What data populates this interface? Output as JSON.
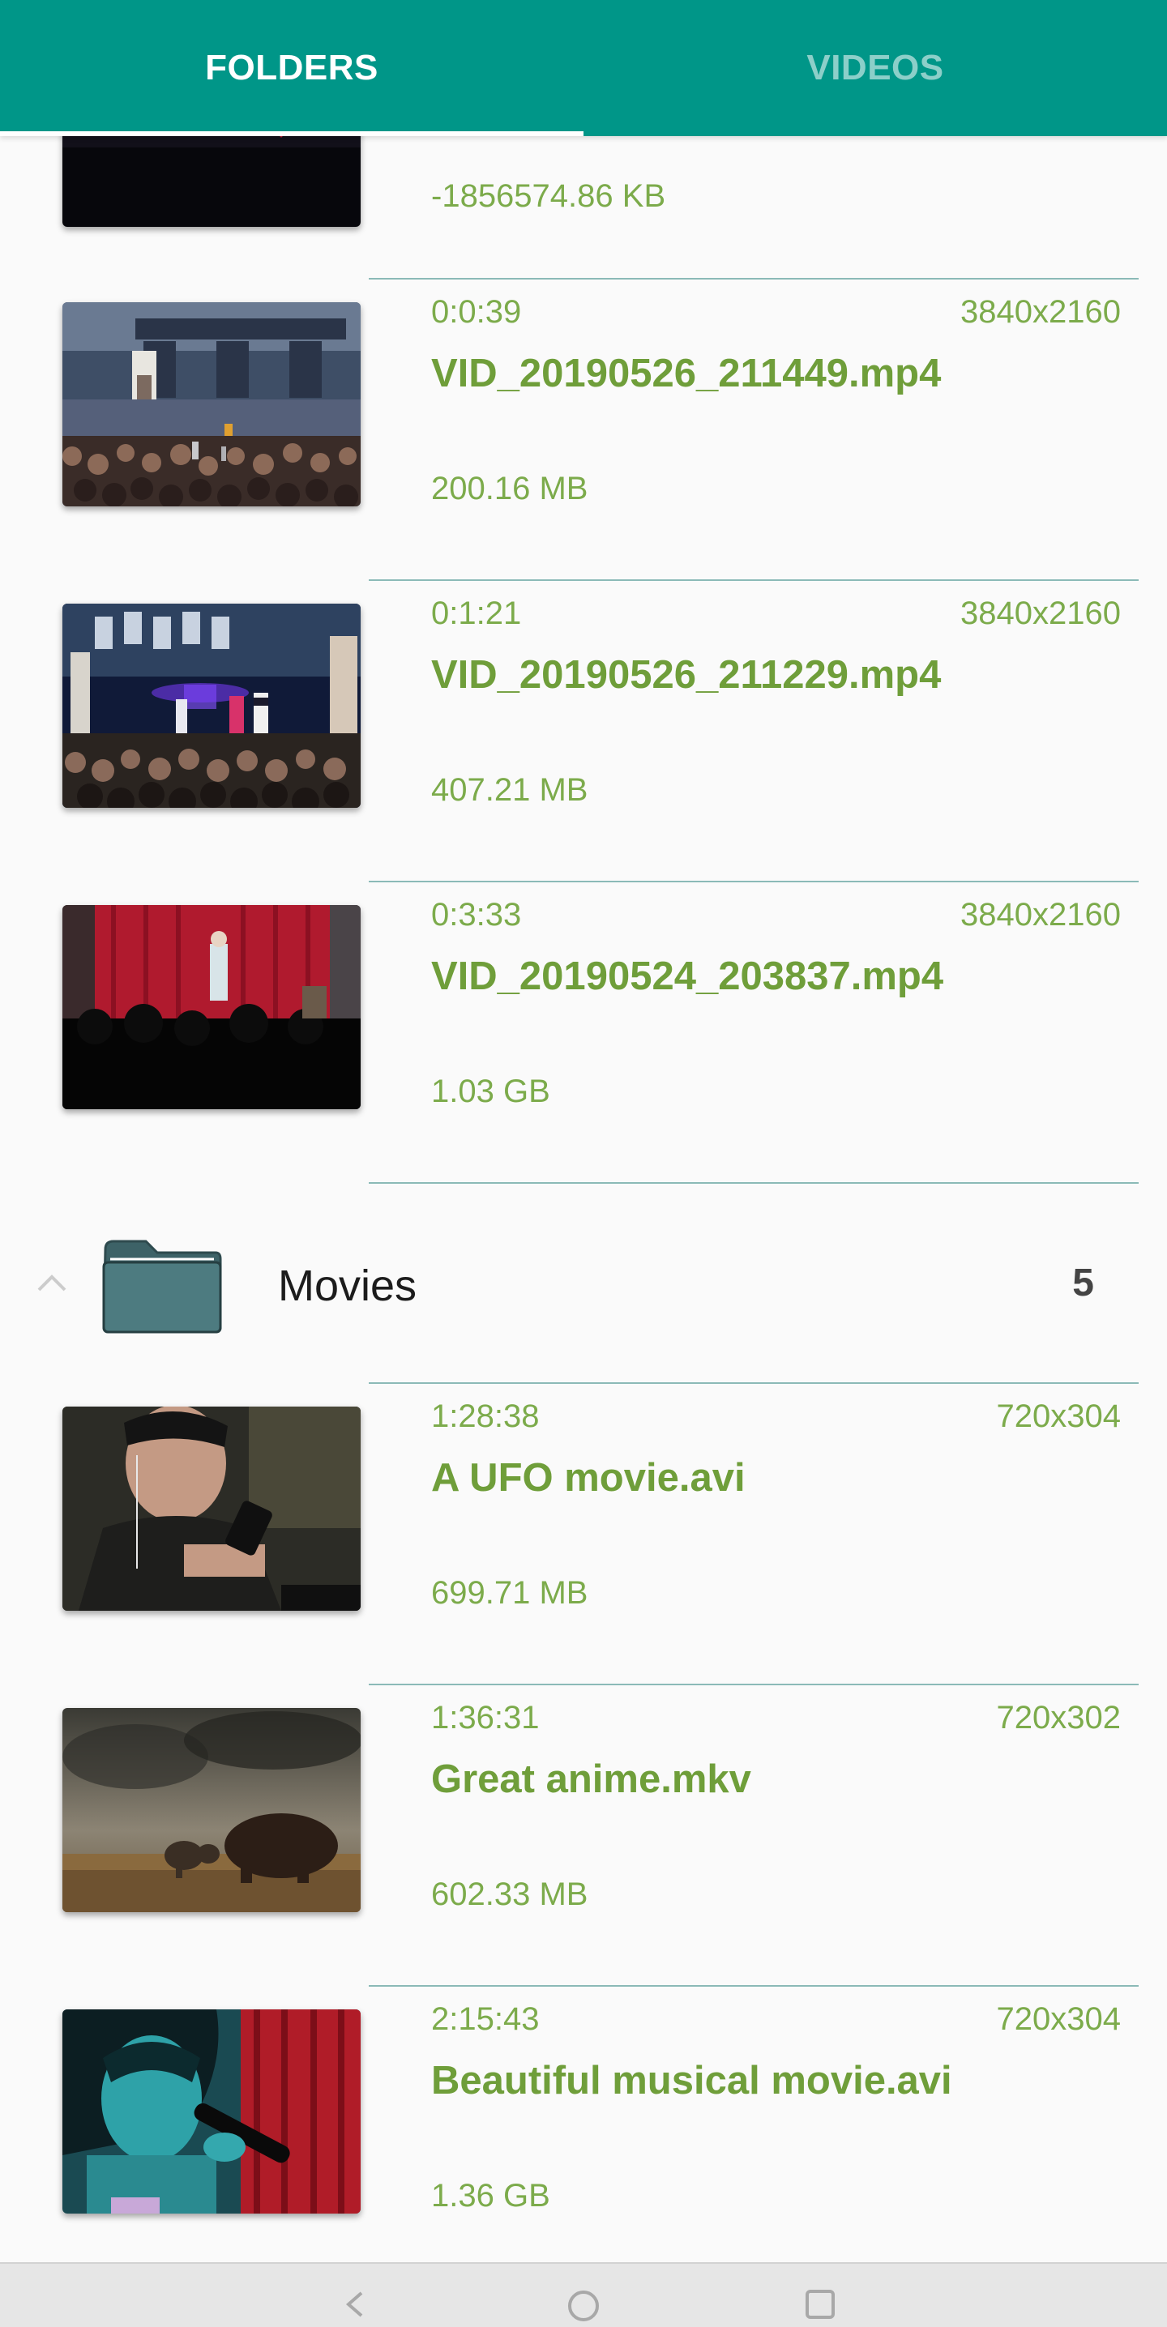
{
  "tabs": [
    {
      "label": "FOLDERS",
      "active": true
    },
    {
      "label": "VIDEOS",
      "active": false
    }
  ],
  "colors": {
    "accent": "#009688",
    "title_green": "#6f9e3a",
    "meta_green": "#7cab4b",
    "divider": "#8bbab7",
    "folder_icon": "#4a7479"
  },
  "partial_item": {
    "size": "-1856574.86 KB"
  },
  "videos": [
    {
      "duration": "0:0:39",
      "resolution": "3840x2160",
      "title": "VID_20190526_211449.mp4",
      "size": "200.16 MB"
    },
    {
      "duration": "0:1:21",
      "resolution": "3840x2160",
      "title": "VID_20190526_211229.mp4",
      "size": "407.21 MB"
    },
    {
      "duration": "0:3:33",
      "resolution": "3840x2160",
      "title": "VID_20190524_203837.mp4",
      "size": "1.03 GB"
    }
  ],
  "folder": {
    "name": "Movies",
    "count": "5",
    "icon": "folder-icon",
    "expand_icon": "chevron-up-icon"
  },
  "movies": [
    {
      "duration": "1:28:38",
      "resolution": "720x304",
      "title": "A UFO movie.avi",
      "size": "699.71 MB"
    },
    {
      "duration": "1:36:31",
      "resolution": "720x302",
      "title": "Great anime.mkv",
      "size": "602.33 MB"
    },
    {
      "duration": "2:15:43",
      "resolution": "720x304",
      "title": "Beautiful musical movie.avi",
      "size": "1.36 GB"
    }
  ],
  "navbar": {
    "icons": [
      "back-icon",
      "home-icon",
      "recents-icon"
    ]
  }
}
